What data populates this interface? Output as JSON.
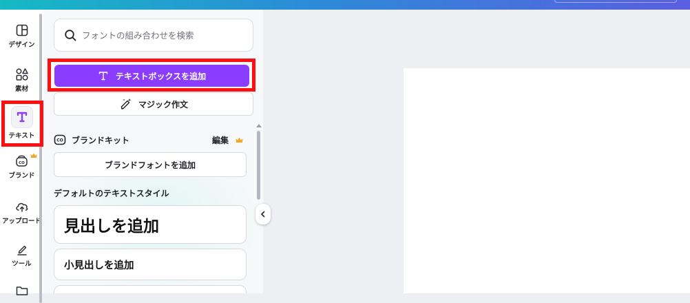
{
  "rail": {
    "items": [
      {
        "label": "デザイン",
        "icon": "layout-icon"
      },
      {
        "label": "素材",
        "icon": "shapes-icon"
      },
      {
        "label": "テキスト",
        "icon": "text-icon",
        "active": true
      },
      {
        "label": "ブランド",
        "icon": "brand-icon",
        "premium": true
      },
      {
        "label": "アップロード",
        "icon": "cloud-upload-icon"
      },
      {
        "label": "ツール",
        "icon": "pen-tool-icon"
      },
      {
        "label": "",
        "icon": "folder-icon"
      }
    ]
  },
  "panel": {
    "search": {
      "placeholder": "フォントの組み合わせを検索"
    },
    "add_textbox_label": "テキストボックスを追加",
    "magic_write_label": "マジック作文",
    "brand_kit": {
      "title": "ブランドキット",
      "edit_label": "編集",
      "add_font_label": "ブランドフォントを追加"
    },
    "default_styles": {
      "title": "デフォルトのテキストスタイル",
      "heading": "見出しを追加",
      "subheading": "小見出しを追加"
    }
  },
  "colors": {
    "accent": "#8b3dff",
    "highlight": "#ff1010",
    "crown": "#f5a623"
  }
}
